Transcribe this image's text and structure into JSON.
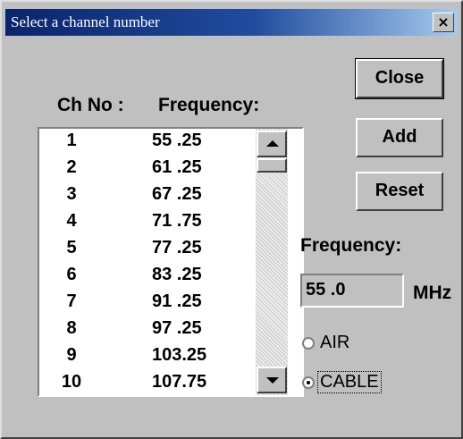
{
  "window": {
    "title": "Select a channel number",
    "close_glyph": "×"
  },
  "list": {
    "col_ch_label": "Ch No :",
    "col_freq_label": "Frequency:",
    "rows": [
      {
        "ch": "1",
        "freq": "55 .25"
      },
      {
        "ch": "2",
        "freq": "61 .25"
      },
      {
        "ch": "3",
        "freq": "67 .25"
      },
      {
        "ch": "4",
        "freq": "71 .75"
      },
      {
        "ch": "5",
        "freq": "77 .25"
      },
      {
        "ch": "6",
        "freq": "83 .25"
      },
      {
        "ch": "7",
        "freq": "91 .25"
      },
      {
        "ch": "8",
        "freq": "97 .25"
      },
      {
        "ch": "9",
        "freq": "103.25"
      },
      {
        "ch": "10",
        "freq": "107.75"
      }
    ]
  },
  "buttons": {
    "close": "Close",
    "add": "Add",
    "reset": "Reset"
  },
  "frequency": {
    "label": "Frequency:",
    "value": "55 .0",
    "unit": "MHz"
  },
  "mode": {
    "air_label": "AIR",
    "cable_label": "CABLE",
    "selected": "CABLE"
  },
  "icons": {
    "scroll_up": "scroll-up-arrow-icon",
    "scroll_down": "scroll-down-arrow-icon"
  }
}
